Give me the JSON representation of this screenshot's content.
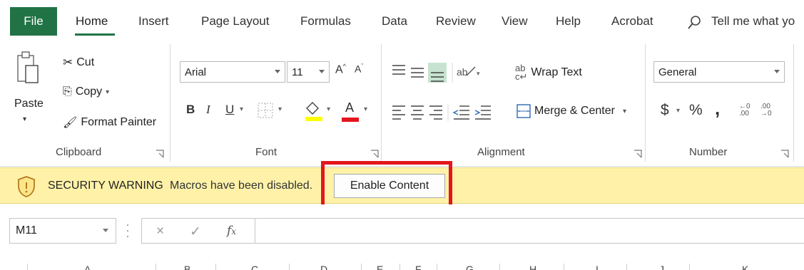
{
  "tabs": {
    "file": "File",
    "home": "Home",
    "insert": "Insert",
    "page_layout": "Page Layout",
    "formulas": "Formulas",
    "data": "Data",
    "review": "Review",
    "view": "View",
    "help": "Help",
    "acrobat": "Acrobat",
    "tell_me": "Tell me what yo"
  },
  "clipboard": {
    "paste": "Paste",
    "cut": "Cut",
    "copy": "Copy",
    "format_painter": "Format Painter",
    "label": "Clipboard"
  },
  "font": {
    "font_name": "Arial",
    "font_size": "11",
    "bold": "B",
    "italic": "I",
    "underline": "U",
    "label": "Font",
    "highlight_color": "#ffff00",
    "font_color": "#e3161d"
  },
  "alignment": {
    "wrap_text": "Wrap Text",
    "merge_center": "Merge & Center",
    "label": "Alignment"
  },
  "number": {
    "format": "General",
    "currency": "$",
    "percent": "%",
    "comma": "̹",
    "label": "Number"
  },
  "security_bar": {
    "title": "SECURITY WARNING",
    "message": "Macros have been disabled.",
    "enable_button": "Enable Content",
    "background": "#fff2a8",
    "highlight_border": "#e3161d"
  },
  "formula_bar": {
    "name_box": "M11",
    "cancel": "×",
    "enter": "✓",
    "fx": "fx",
    "formula_value": ""
  },
  "columns": [
    "A",
    "B",
    "C",
    "D",
    "E",
    "F",
    "G",
    "H",
    "I",
    "J",
    "K"
  ],
  "colors": {
    "brand": "#217346"
  }
}
